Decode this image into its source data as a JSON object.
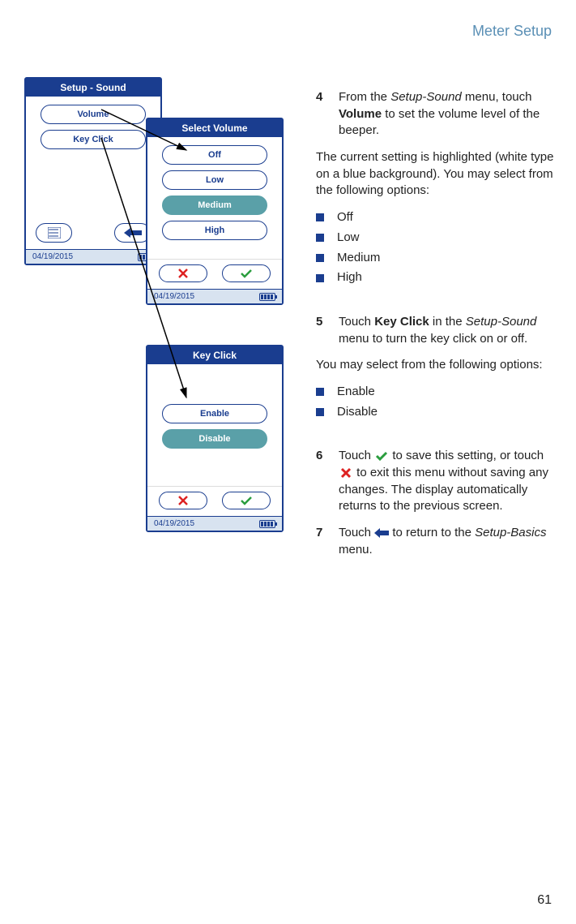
{
  "header": {
    "title": "Meter Setup"
  },
  "footer": {
    "page": "61"
  },
  "screens": {
    "setup_sound": {
      "title": "Setup - Sound",
      "items": [
        "Volume",
        "Key Click"
      ],
      "date": "04/19/2015"
    },
    "select_volume": {
      "title": "Select Volume",
      "options": [
        "Off",
        "Low",
        "Medium",
        "High"
      ],
      "selected_index": 2,
      "date": "04/19/2015"
    },
    "key_click": {
      "title": "Key Click",
      "options": [
        "Enable",
        "Disable"
      ],
      "selected_index": 1,
      "date": "04/19/2015"
    }
  },
  "steps": {
    "s4": {
      "num": "4",
      "pre": "From the ",
      "italic1": "Setup-Sound",
      "mid": " menu, touch ",
      "bold": "Volume",
      "post": " to set the volume level of the beeper."
    },
    "s4_para": "The current setting is highlighted (white type on a blue background). You may select from the following options:",
    "s4_bullets": [
      "Off",
      "Low",
      "Medium",
      "High"
    ],
    "s5": {
      "num": "5",
      "pre": "Touch ",
      "bold": "Key Click",
      "mid": " in the ",
      "italic1": "Setup-Sound",
      "post": " menu to turn the key click on or off."
    },
    "s5_para": "You may select from the following options:",
    "s5_bullets": [
      "Enable",
      "Disable"
    ],
    "s6": {
      "num": "6",
      "pre": "Touch ",
      "mid": " to save this setting, or touch ",
      "post": " to exit this menu without saving any changes. The display automatically returns to the previous screen."
    },
    "s7": {
      "num": "7",
      "pre": "Touch ",
      "mid": " to return to the ",
      "italic1": "Setup-Basics",
      "post": " menu."
    }
  }
}
